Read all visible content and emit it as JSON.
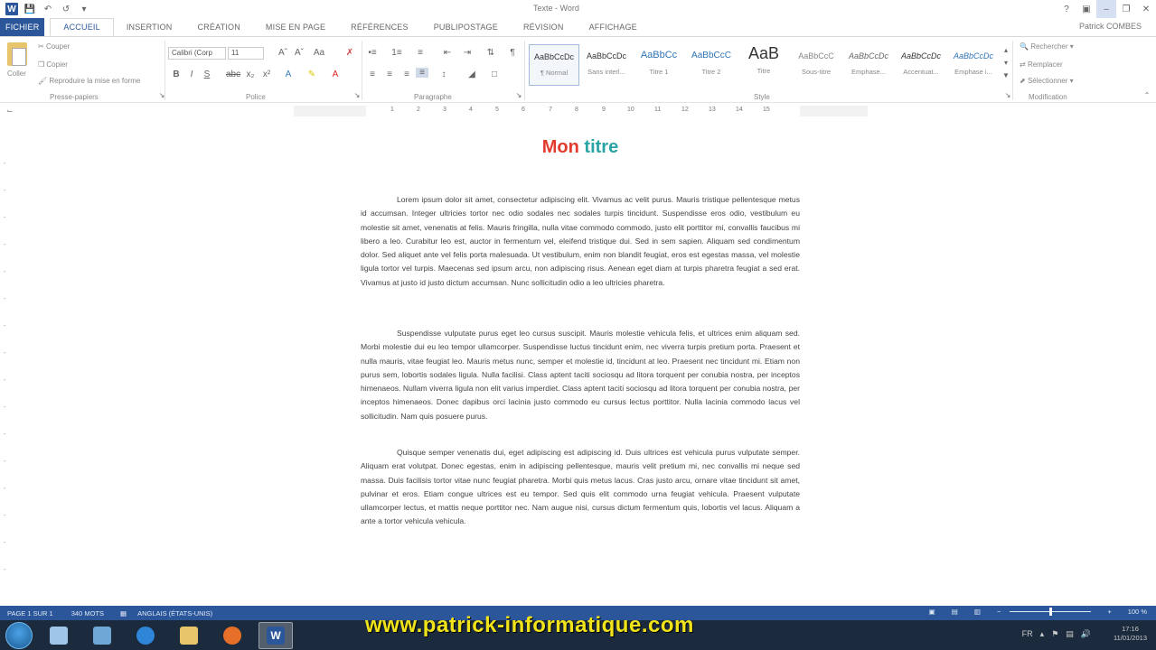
{
  "window": {
    "title": "Texte - Word",
    "user": "Patrick COMBES"
  },
  "tabs": [
    "FICHIER",
    "ACCUEIL",
    "INSERTION",
    "CRÉATION",
    "MISE EN PAGE",
    "RÉFÉRENCES",
    "PUBLIPOSTAGE",
    "RÉVISION",
    "AFFICHAGE"
  ],
  "clipboard": {
    "paste": "Coller",
    "cut": "Couper",
    "copy": "Copier",
    "format_painter": "Reproduire la mise en forme",
    "label": "Presse-papiers"
  },
  "font": {
    "name": "Calibri (Corp",
    "size": "11",
    "label": "Police"
  },
  "paragraph": {
    "label": "Paragraphe"
  },
  "styles": {
    "label": "Style",
    "items": [
      {
        "sample": "AaBbCcDc",
        "name": "¶ Normal"
      },
      {
        "sample": "AaBbCcDc",
        "name": "Sans interl..."
      },
      {
        "sample": "AaBbCc",
        "name": "Titre 1"
      },
      {
        "sample": "AaBbCcC",
        "name": "Titre 2"
      },
      {
        "sample": "AaB",
        "name": "Titre"
      },
      {
        "sample": "AaBbCcC",
        "name": "Sous-titre"
      },
      {
        "sample": "AaBbCcDc",
        "name": "Emphase..."
      },
      {
        "sample": "AaBbCcDc",
        "name": "Accentuat..."
      },
      {
        "sample": "AaBbCcDc",
        "name": "Emphase i..."
      }
    ]
  },
  "editing": {
    "find": "Rechercher",
    "replace": "Remplacer",
    "select": "Sélectionner",
    "label": "Modification"
  },
  "document": {
    "heading_part1": "Mon",
    "heading_part2": "titre",
    "paragraphs": [
      "Lorem ipsum dolor sit amet, consectetur adipiscing elit. Vivamus ac velit purus. Mauris tristique pellentesque metus id accumsan. Integer ultricies tortor nec odio sodales nec sodales turpis tincidunt. Suspendisse eros odio, vestibulum eu molestie sit amet, venenatis at felis. Mauris fringilla, nulla vitae commodo commodo, justo elit porttitor mi, convallis faucibus mi libero a leo. Curabitur leo est, auctor in fermentum vel, eleifend tristique dui. Sed in sem sapien. Aliquam sed condimentum dolor. Sed aliquet ante vel felis porta malesuada. Ut vestibulum, enim non blandit feugiat, eros est egestas massa, vel molestie ligula tortor vel turpis. Maecenas sed ipsum arcu, non adipiscing risus. Aenean eget diam at turpis pharetra feugiat a sed erat. Vivamus at justo id justo dictum accumsan. Nunc sollicitudin odio a leo ultricies pharetra.",
      "Suspendisse vulputate purus eget leo cursus suscipit. Mauris molestie vehicula felis, et ultrices enim aliquam sed. Morbi molestie dui eu leo tempor ullamcorper. Suspendisse luctus tincidunt enim, nec viverra turpis pretium porta. Praesent et nulla mauris, vitae feugiat leo. Mauris metus nunc, semper et molestie id, tincidunt at leo. Praesent nec tincidunt mi. Etiam non purus sem, lobortis sodales ligula. Nulla facilisi. Class aptent taciti sociosqu ad litora torquent per conubia nostra, per inceptos himenaeos. Nullam viverra ligula non elit varius imperdiet. Class aptent taciti sociosqu ad litora torquent per conubia nostra, per inceptos himenaeos. Donec dapibus orci lacinia justo commodo eu cursus lectus porttitor. Nulla lacinia commodo lacus vel sollicitudin. Nam quis posuere purus.",
      "Quisque semper venenatis dui, eget adipiscing est adipiscing id. Duis ultrices est vehicula purus vulputate semper. Aliquam erat volutpat. Donec egestas, enim in adipiscing pellentesque, mauris velit pretium mi, nec convallis mi neque sed massa. Duis facilisis tortor vitae nunc feugiat pharetra. Morbi quis metus lacus. Cras justo arcu, ornare vitae tincidunt sit amet, pulvinar et eros. Etiam congue ultrices est eu tempor. Sed quis elit commodo urna feugiat vehicula. Praesent vulputate ullamcorper lectus, et mattis neque porttitor nec. Nam augue nisi, cursus dictum fermentum quis, lobortis vel lacus. Aliquam a ante a tortor vehicula vehicula."
    ]
  },
  "status": {
    "page": "PAGE 1 SUR 1",
    "words": "340 MOTS",
    "language": "ANGLAIS (ÉTATS-UNIS)",
    "zoom": "100 %"
  },
  "taskbar": {
    "watermark": "www.patrick-informatique.com",
    "time": "17:16",
    "date": "11/01/2013",
    "lang": "FR"
  },
  "colors": {
    "word_blue": "#2b579a",
    "heading_red": "#e23b2e",
    "heading_teal": "#29a3a3",
    "watermark_yellow": "#f1e31a"
  }
}
